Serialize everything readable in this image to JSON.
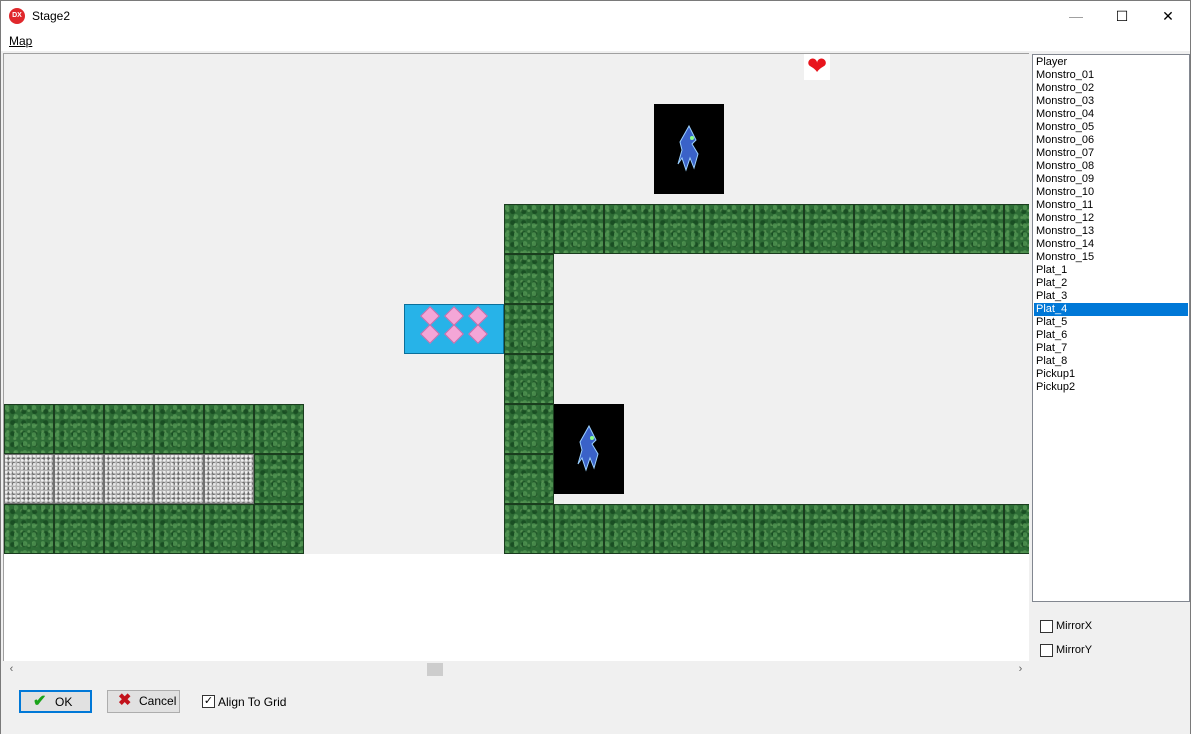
{
  "window": {
    "title": "Stage2",
    "app_icon": "DX",
    "controls": {
      "minimize": "—",
      "maximize": "☐",
      "close": "✕"
    }
  },
  "menu": {
    "map_label": "Map"
  },
  "map": {
    "tiles": {
      "grass": "grass-tile",
      "stone": "stone-tile",
      "ice": "ice-block",
      "monster": "monster-sprite",
      "heart": "heart-pickup"
    },
    "heart_glyph": "❤"
  },
  "scrollbar": {
    "left_arrow": "‹",
    "right_arrow": "›"
  },
  "object_list": {
    "items": [
      "Player",
      "Monstro_01",
      "Monstro_02",
      "Monstro_03",
      "Monstro_04",
      "Monstro_05",
      "Monstro_06",
      "Monstro_07",
      "Monstro_08",
      "Monstro_09",
      "Monstro_10",
      "Monstro_11",
      "Monstro_12",
      "Monstro_13",
      "Monstro_14",
      "Monstro_15",
      "Plat_1",
      "Plat_2",
      "Plat_3",
      "Plat_4",
      "Plat_5",
      "Plat_6",
      "Plat_7",
      "Plat_8",
      "Pickup1",
      "Pickup2"
    ],
    "selected": "Plat_4"
  },
  "options": {
    "mirror_x": {
      "label": "MirrorX",
      "checked": false
    },
    "mirror_y": {
      "label": "MirrorY",
      "checked": false
    }
  },
  "footer": {
    "ok_label": "OK",
    "cancel_label": "Cancel",
    "align_to_grid": {
      "label": "Align To Grid",
      "checked": true
    }
  },
  "colors": {
    "selection": "#0078d7",
    "grass": "#2e6d36",
    "ice": "#27b3e8",
    "gem": "#f4a6d7",
    "heart": "#e8141c"
  }
}
